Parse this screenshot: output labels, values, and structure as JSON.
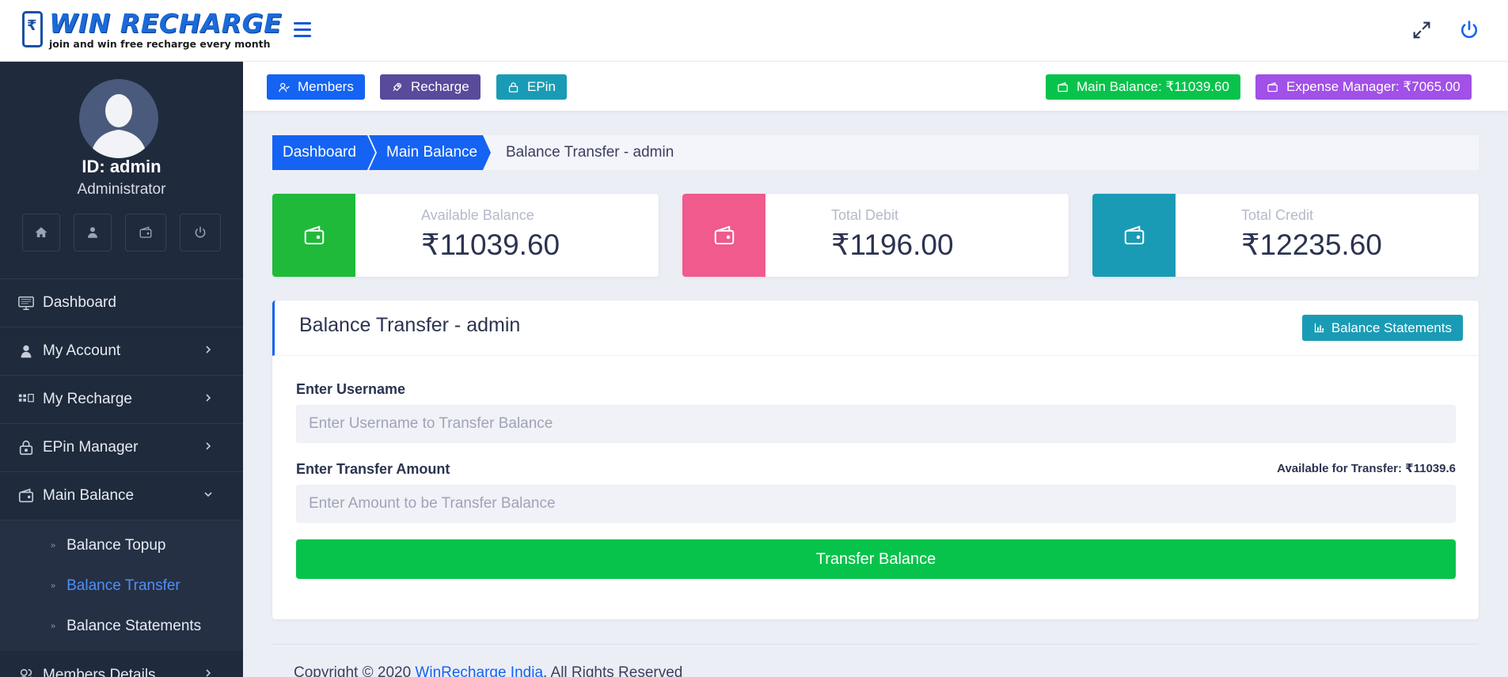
{
  "brand": {
    "title": "WIN RECHARGE",
    "tagline": "join and win free recharge every month",
    "phone_symbol": "₹"
  },
  "header_icons": [
    "menu-icon",
    "fullscreen-icon",
    "power-icon"
  ],
  "sidebar": {
    "user_id": "ID: admin",
    "role": "Administrator",
    "quick_icons": [
      "home-icon",
      "user-icon",
      "wallet-icon",
      "power-icon"
    ],
    "items": [
      {
        "label": "Dashboard",
        "icon": "monitor-icon",
        "has_arrow": false
      },
      {
        "label": "My Account",
        "icon": "user-icon",
        "has_arrow": true
      },
      {
        "label": "My Recharge",
        "icon": "grid-icon",
        "has_arrow": true
      },
      {
        "label": "EPin Manager",
        "icon": "lock-icon",
        "has_arrow": true
      },
      {
        "label": "Main Balance",
        "icon": "wallet-icon",
        "has_arrow": true,
        "expanded": true
      },
      {
        "label": "Members Details",
        "icon": "users-icon",
        "has_arrow": true
      }
    ],
    "submenu": [
      {
        "label": "Balance Topup",
        "active": false
      },
      {
        "label": "Balance Transfer",
        "active": true
      },
      {
        "label": "Balance Statements",
        "active": false
      }
    ]
  },
  "actionbar": {
    "members": "Members",
    "recharge": "Recharge",
    "epin": "EPin",
    "main_balance": "Main Balance: ₹11039.60",
    "expense_manager": "Expense Manager: ₹7065.00"
  },
  "breadcrumb": {
    "items": [
      "Dashboard",
      "Main Balance"
    ],
    "current": "Balance Transfer - admin"
  },
  "cards": [
    {
      "label": "Available Balance",
      "value": "₹11039.60",
      "color": "#1fba3a"
    },
    {
      "label": "Total Debit",
      "value": "₹1196.00",
      "color": "#f05a8c"
    },
    {
      "label": "Total Credit",
      "value": "₹12235.60",
      "color": "#1a9bb5"
    }
  ],
  "form": {
    "title": "Balance Transfer - admin",
    "statements_button": "Balance Statements",
    "username_label": "Enter Username",
    "username_placeholder": "Enter Username to Transfer Balance",
    "amount_label": "Enter Transfer Amount",
    "amount_placeholder": "Enter Amount to be Transfer Balance",
    "available_note": "Available for Transfer: ₹11039.6",
    "submit": "Transfer Balance"
  },
  "footer": {
    "prefix": "Copyright © 2020 ",
    "link": "WinRecharge India",
    "suffix": ". All Rights Reserved"
  },
  "colors": {
    "primary": "#1463f3",
    "members_btn": "#1463f3",
    "recharge_btn": "#5a4a9c",
    "epin_btn": "#1a9bb5",
    "main_balance_btn": "#08c34b",
    "expense_btn": "#a150e8",
    "sidebar_bg": "#1f2a3c"
  }
}
